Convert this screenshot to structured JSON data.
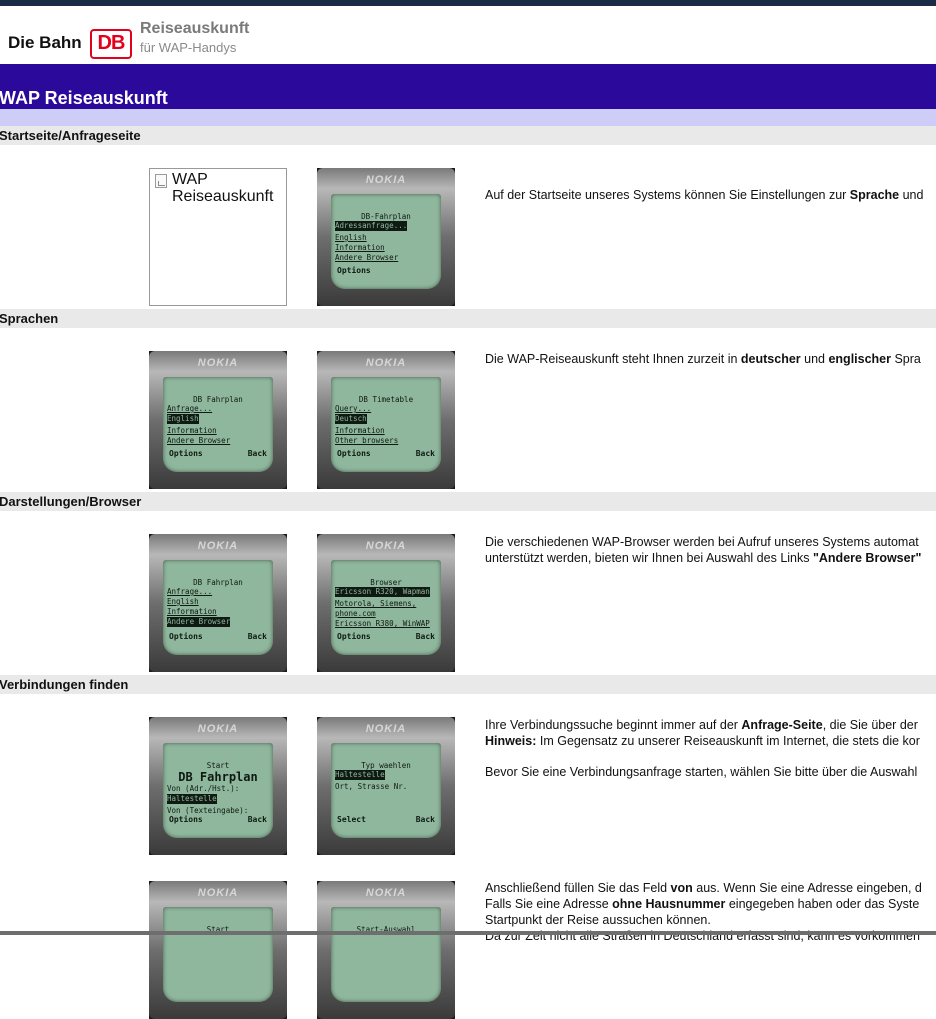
{
  "header": {
    "brand": "Die Bahn",
    "logo": "DB",
    "service_title": "Reiseauskunft",
    "service_subtitle": "für WAP-Handys"
  },
  "banner": {
    "title": "WAP Reiseauskunft"
  },
  "sections": {
    "start": {
      "label": "Startseite/Anfrageseite"
    },
    "lang": {
      "label": "Sprachen"
    },
    "display": {
      "label": "Darstellungen/Browser"
    },
    "conn": {
      "label": "Verbindungen finden"
    }
  },
  "placeholder": {
    "line1": "WAP",
    "line2": "Reiseauskunft"
  },
  "phones": {
    "brand": "NOKIA",
    "p1": {
      "header": "DB-Fahrplan",
      "rows": [
        "Adressanfrage...",
        "English",
        "Information",
        "Andere Browser"
      ],
      "left": "Options",
      "right": ""
    },
    "p2": {
      "header": "DB Fahrplan",
      "rows": [
        "Anfrage...",
        "English",
        "Information",
        "Andere Browser"
      ],
      "left": "Options",
      "right": "Back"
    },
    "p3": {
      "header": "DB Timetable",
      "rows": [
        "Query...",
        "Deutsch",
        "Information",
        "Other browsers"
      ],
      "left": "Options",
      "right": "Back"
    },
    "p4": {
      "header": "DB Fahrplan",
      "rows": [
        "Anfrage...",
        "English",
        "Information",
        "Andere Browser"
      ],
      "left": "Options",
      "right": "Back"
    },
    "p5": {
      "header": "Browser",
      "rows": [
        "Ericsson R320, Wapman",
        "Motorola, Siemens,",
        "phone.com",
        "Ericsson R380, WinWAP"
      ],
      "left": "Options",
      "right": "Back"
    },
    "p6": {
      "header": "Start",
      "big": "DB Fahrplan",
      "rows": [
        "Von (Adr./Hst.):",
        "Haltestelle",
        "Von (Texteingabe):"
      ],
      "left": "Options",
      "right": "Back"
    },
    "p7": {
      "header": "Typ waehlen",
      "rows": [
        "Haltestelle",
        "Ort, Strasse Nr."
      ],
      "left": "Select",
      "right": "Back"
    },
    "p8": {
      "header": "Start"
    },
    "p9": {
      "header": "Start-Auswahl"
    }
  },
  "descriptions": {
    "d1": {
      "pre": "Auf der Startseite unseres Systems können Sie Einstellungen zur ",
      "bold": "Sprache",
      "post": " und"
    },
    "d2": {
      "pre": "Die WAP-Reiseauskunft steht Ihnen zurzeit in ",
      "bold1": "deutscher",
      "mid": " und ",
      "bold2": "englischer",
      "post": " Spra"
    },
    "d3": {
      "line1": "Die verschiedenen WAP-Browser werden bei Aufruf unseres Systems automat",
      "line2_pre": "unterstützt werden, bieten wir Ihnen bei Auswahl des Links ",
      "line2_bold": "\"Andere Browser\""
    },
    "d4": {
      "line1_pre": "Ihre Verbindungssuche beginnt immer auf der ",
      "line1_bold": "Anfrage-Seite",
      "line1_post": ", die Sie über der",
      "line2_bold": "Hinweis:",
      "line2_post": " Im Gegensatz zu unserer Reiseauskunft im Internet, die stets die kor",
      "line3": "Bevor Sie eine Verbindungsanfrage starten, wählen Sie bitte über die Auswahl"
    },
    "d5": {
      "line1_pre": "Anschließend füllen Sie das Feld ",
      "line1_bold": "von",
      "line1_post": " aus. Wenn Sie eine Adresse eingeben, d",
      "line2_pre": "Falls Sie eine Adresse ",
      "line2_bold": "ohne Hausnummer",
      "line2_post": " eingegeben haben oder das Syste",
      "line3": "Startpunkt der Reise aussuchen können.",
      "line4": "Da zur Zeit nicht alle Straßen in Deutschland erfasst sind, kann es vorkommen"
    }
  }
}
